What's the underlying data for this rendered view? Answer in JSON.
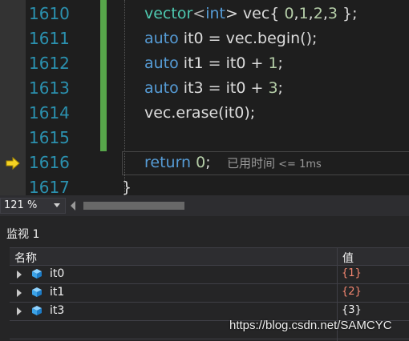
{
  "editor": {
    "lines": [
      {
        "num": "1610"
      },
      {
        "num": "1611"
      },
      {
        "num": "1612"
      },
      {
        "num": "1613"
      },
      {
        "num": "1614"
      },
      {
        "num": "1615"
      },
      {
        "num": "1616"
      },
      {
        "num": "1617"
      }
    ],
    "code": {
      "l1610": {
        "t1": "vector",
        "t2": "<",
        "t3": "int",
        "t4": "> vec{ ",
        "t5": "0",
        "t6": ",",
        "t7": "1",
        "t8": ",",
        "t9": "2",
        "t10": ",",
        "t11": "3",
        "t12": " };"
      },
      "l1611": {
        "kw": "auto",
        "rest": " it0 = vec.begin();"
      },
      "l1612": {
        "kw": "auto",
        "rest1": " it1 = it0 + ",
        "num": "1",
        "rest2": ";"
      },
      "l1613": {
        "kw": "auto",
        "rest1": " it3 = it0 + ",
        "num": "3",
        "rest2": ";"
      },
      "l1614": {
        "rest": "vec.erase(it0);"
      },
      "l1616": {
        "kw": "return",
        "rest1": " ",
        "num": "0",
        "rest2": ";"
      },
      "l1617": {
        "rest": "}"
      }
    },
    "perf_tip": {
      "label": "已用时间",
      "time": " <= 1ms"
    },
    "colors": {
      "line_number": "#2b91af",
      "keyword": "#569cd6",
      "type": "#4ec9b0",
      "number": "#b5cea8",
      "change_bar": "#57a64a"
    }
  },
  "zoom": {
    "level": "121 %"
  },
  "watch": {
    "title": "监视 1",
    "columns": {
      "name": "名称",
      "value": "值"
    },
    "rows": [
      {
        "name": "it0",
        "value": "{1}",
        "value_color": "#f48771"
      },
      {
        "name": "it1",
        "value": "{2}",
        "value_color": "#f48771"
      },
      {
        "name": "it3",
        "value": "{3}",
        "value_color": "#f1f1f1"
      }
    ]
  },
  "watermark": "https://blog.csdn.net/SAMCYC",
  "icons": {
    "execution_arrow": "yellow-arrow-icon",
    "variable": "blue-cube-icon",
    "expander": "triangle-right-icon"
  }
}
